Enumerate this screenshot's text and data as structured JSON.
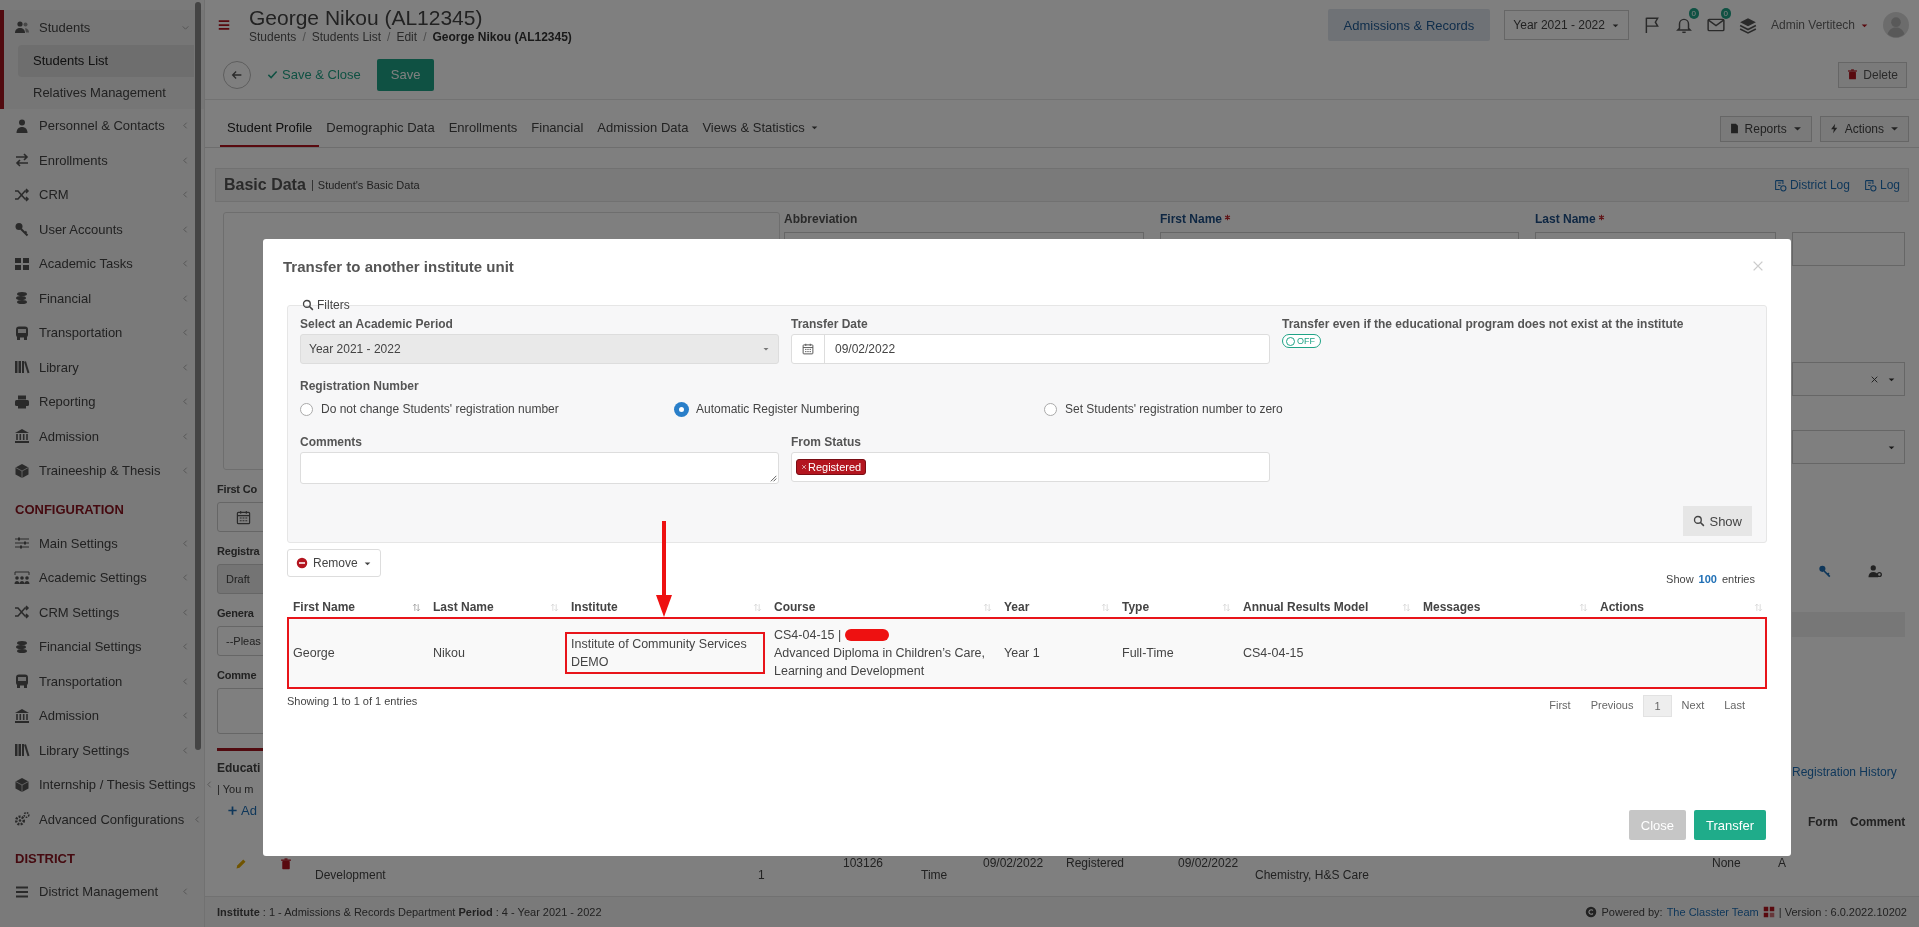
{
  "sidebar": {
    "items": [
      {
        "label": "Students",
        "selected": true,
        "expanded": true,
        "children": [
          {
            "label": "Students List",
            "selected": true
          },
          {
            "label": "Relatives Management",
            "selected": false
          }
        ]
      },
      {
        "label": "Personnel & Contacts",
        "selected": false,
        "expanded": false
      },
      {
        "label": "Enrollments",
        "selected": false,
        "expanded": false
      },
      {
        "label": "CRM",
        "selected": false,
        "expanded": false
      },
      {
        "label": "User Accounts",
        "selected": false,
        "expanded": false
      },
      {
        "label": "Academic Tasks",
        "selected": false,
        "expanded": false
      },
      {
        "label": "Financial",
        "selected": false,
        "expanded": false
      },
      {
        "label": "Transportation",
        "selected": false,
        "expanded": false
      },
      {
        "label": "Library",
        "selected": false,
        "expanded": false
      },
      {
        "label": "Reporting",
        "selected": false,
        "expanded": false
      },
      {
        "label": "Admission",
        "selected": false,
        "expanded": false
      },
      {
        "label": "Traineeship & Thesis",
        "selected": false,
        "expanded": false
      }
    ],
    "sections": [
      {
        "heading": "CONFIGURATION",
        "items": [
          {
            "label": "Main Settings",
            "selected": false,
            "expanded": false
          },
          {
            "label": "Academic Settings",
            "selected": false,
            "expanded": false
          },
          {
            "label": "CRM Settings",
            "selected": false,
            "expanded": false
          },
          {
            "label": "Financial Settings",
            "selected": false,
            "expanded": false
          },
          {
            "label": "Transportation",
            "selected": false,
            "expanded": false
          },
          {
            "label": "Admission",
            "selected": false,
            "expanded": false
          },
          {
            "label": "Library Settings",
            "selected": false,
            "expanded": false
          },
          {
            "label": "Internship / Thesis Settings",
            "selected": false,
            "expanded": false
          },
          {
            "label": "Advanced Configurations",
            "selected": false,
            "expanded": false
          }
        ]
      },
      {
        "heading": "DISTRICT",
        "items": [
          {
            "label": "District Management",
            "selected": false,
            "expanded": false
          }
        ]
      }
    ]
  },
  "header": {
    "title": "George Nikou (AL12345)",
    "separator": "/",
    "breadcrumb": [
      {
        "label": "Students",
        "current": false
      },
      {
        "label": "Students List",
        "current": false
      },
      {
        "label": "Edit",
        "current": false
      },
      {
        "label": "George Nikou (AL12345)",
        "current": true
      }
    ],
    "module_button": "Admissions & Records",
    "year_select": "Year 2021 - 2022",
    "badges": [
      {
        "count": "0"
      },
      {
        "count": "0"
      }
    ],
    "user": "Admin Vertitech"
  },
  "toolbar": {
    "save_close": "Save & Close",
    "save": "Save",
    "delete": "Delete"
  },
  "tabs": [
    {
      "label": "Student Profile",
      "selected": true,
      "dropdown": false
    },
    {
      "label": "Demographic Data",
      "selected": false,
      "dropdown": false
    },
    {
      "label": "Enrollments",
      "selected": false,
      "dropdown": false
    },
    {
      "label": "Financial",
      "selected": false,
      "dropdown": false
    },
    {
      "label": "Admission Data",
      "selected": false,
      "dropdown": false
    },
    {
      "label": "Views & Statistics",
      "selected": false,
      "dropdown": true
    }
  ],
  "tab_actions": [
    "Reports",
    "Actions"
  ],
  "panel": {
    "title": "Basic Data",
    "subtitle": "Student's Basic Data",
    "links": [
      "District Log",
      "Log"
    ]
  },
  "form": {
    "labels": [
      {
        "label": "Abbreviation",
        "required": false
      },
      {
        "label": "First Name",
        "required": true
      },
      {
        "label": "Last Name",
        "required": true
      }
    ],
    "left_column": [
      {
        "kind": "label",
        "text": "First Co"
      },
      {
        "kind": "date-input"
      },
      {
        "kind": "label",
        "text": "Registra"
      },
      {
        "kind": "select",
        "text": "Draft"
      },
      {
        "kind": "label",
        "text": "Genera"
      },
      {
        "kind": "input",
        "text": "--Pleas"
      },
      {
        "kind": "label",
        "text": "Comme"
      },
      {
        "kind": "textarea"
      },
      {
        "kind": "rule"
      },
      {
        "kind": "section-title",
        "text": "Educati"
      },
      {
        "kind": "note",
        "text": "| You m"
      },
      {
        "kind": "add-link",
        "text": "Ad"
      }
    ],
    "right_column": [
      {
        "kind": "input"
      },
      {
        "kind": "clearable-select"
      },
      {
        "kind": "select"
      },
      {
        "kind": "row-icons"
      },
      {
        "kind": "bar"
      },
      {
        "kind": "link",
        "text": "Registration History"
      },
      {
        "kind": "headers",
        "texts": [
          "Form",
          "Comment"
        ]
      }
    ]
  },
  "bottom_row": {
    "cells": [
      "Development",
      "1",
      "103126",
      "Time",
      "09/02/2022",
      "Registered",
      "09/02/2022",
      "Chemistry, H&S Care",
      "None",
      "A"
    ]
  },
  "footer": {
    "info": "**Institute** : 1 - Admissions & Records Department **Period** : 4 - Year 2021 - 2022",
    "powered": "Powered by:",
    "team": "The Classter Team",
    "version": "| Version : 6.0.2022.10202"
  },
  "modal": {
    "title": "Transfer to another institute unit",
    "filters": {
      "legend": "Filters",
      "academic_period": {
        "label": "Select an Academic Period",
        "value": "Year 2021 - 2022",
        "disabled": true
      },
      "transfer_date": {
        "label": "Transfer Date",
        "value": "09/02/2022"
      },
      "transfer_even": {
        "label": "Transfer even if the educational program does not exist at the institute",
        "on": false,
        "state_text": "OFF"
      },
      "registration_number": {
        "label": "Registration Number",
        "options": [
          {
            "label": "Do not change Students' registration number",
            "selected": false
          },
          {
            "label": "Automatic Register Numbering",
            "selected": true
          },
          {
            "label": "Set Students' registration number to zero",
            "selected": false
          }
        ]
      },
      "comments": {
        "label": "Comments"
      },
      "from_status": {
        "label": "From Status",
        "tags": [
          "Registered"
        ]
      },
      "show_button": "Show"
    },
    "remove_button": "Remove",
    "page_length": {
      "prefix": "Show",
      "value": "100",
      "suffix": "entries"
    },
    "table": {
      "columns": [
        {
          "label": "First Name",
          "sorted": true
        },
        {
          "label": "Last Name",
          "sorted": false
        },
        {
          "label": "Institute",
          "sorted": false
        },
        {
          "label": "Course",
          "sorted": false
        },
        {
          "label": "Year",
          "sorted": false
        },
        {
          "label": "Type",
          "sorted": false
        },
        {
          "label": "Annual Results Model",
          "sorted": false
        },
        {
          "label": "Messages",
          "sorted": false
        },
        {
          "label": "Actions",
          "sorted": false
        }
      ],
      "rows": [
        {
          "first_name": "George",
          "last_name": "Nikou",
          "institute": "Institute of Community Services DEMO",
          "course": {
            "code": "CS4-04-15 |",
            "redacted": true,
            "title": "Advanced Diploma in Children’s Care, Learning and Development"
          },
          "year": "Year 1",
          "type": "Full-Time",
          "annual_results_model": "CS4-04-15"
        }
      ]
    },
    "info": "Showing 1 to 1 of 1 entries",
    "pagination": [
      {
        "label": "First",
        "selected": false
      },
      {
        "label": "Previous",
        "selected": false
      },
      {
        "label": "1",
        "selected": true
      },
      {
        "label": "Next",
        "selected": false
      },
      {
        "label": "Last",
        "selected": false
      }
    ],
    "buttons": [
      {
        "label": "Close",
        "kind": "secondary"
      },
      {
        "label": "Transfer",
        "kind": "primary"
      }
    ]
  }
}
